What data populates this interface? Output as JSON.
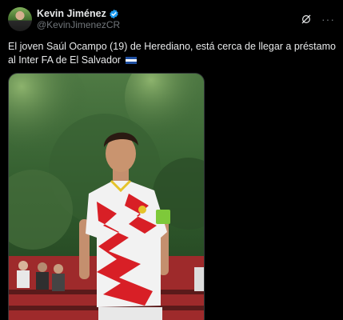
{
  "author": {
    "display_name": "Kevin Jiménez",
    "handle": "@KevinJimenezCR",
    "verified": true,
    "avatar_icon": "avatar-photo"
  },
  "actions": {
    "grok_icon": "grok-icon",
    "more_icon": "more-options-icon"
  },
  "tweet": {
    "text": "El joven Saúl Ocampo (19) de Herediano, está cerca de llegar a préstamo al Inter FA de El Salvador",
    "flag_icon": "el-salvador-flag-icon"
  },
  "media": {
    "type": "photo",
    "subject": "soccer-player-photo"
  },
  "colors": {
    "background": "#000000",
    "text": "#e7e9ea",
    "secondary": "#71767b",
    "verified": "#1d9bf0",
    "jersey_red": "#d81f26"
  }
}
